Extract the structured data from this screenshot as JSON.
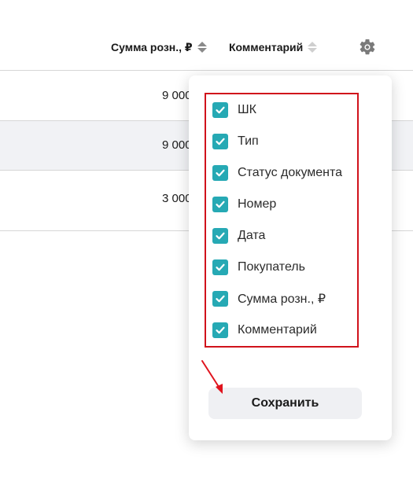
{
  "table": {
    "headers": [
      {
        "label": "Сумма розн., ₽"
      },
      {
        "label": "Комментарий"
      }
    ],
    "rows": [
      {
        "sum": "9 000"
      },
      {
        "sum": "9 000"
      },
      {
        "sum": "3 000"
      }
    ]
  },
  "icons": {
    "settings": "gear-icon",
    "sort": "sort-arrows-icon",
    "check": "check-icon"
  },
  "popup": {
    "columns": [
      {
        "label": "ШК",
        "checked": true
      },
      {
        "label": "Тип",
        "checked": true
      },
      {
        "label": "Статус документа",
        "checked": true
      },
      {
        "label": "Номер",
        "checked": true
      },
      {
        "label": "Дата",
        "checked": true
      },
      {
        "label": "Покупатель",
        "checked": true
      },
      {
        "label": "Сумма розн., ₽",
        "checked": true
      },
      {
        "label": "Комментарий",
        "checked": true
      }
    ],
    "save_label": "Сохранить"
  },
  "colors": {
    "checkbox": "#26a9b4",
    "highlight_border": "#d0121b",
    "annotation_arrow": "#e0141e",
    "row_alt_bg": "#f1f2f5",
    "button_bg": "#eff0f3"
  }
}
